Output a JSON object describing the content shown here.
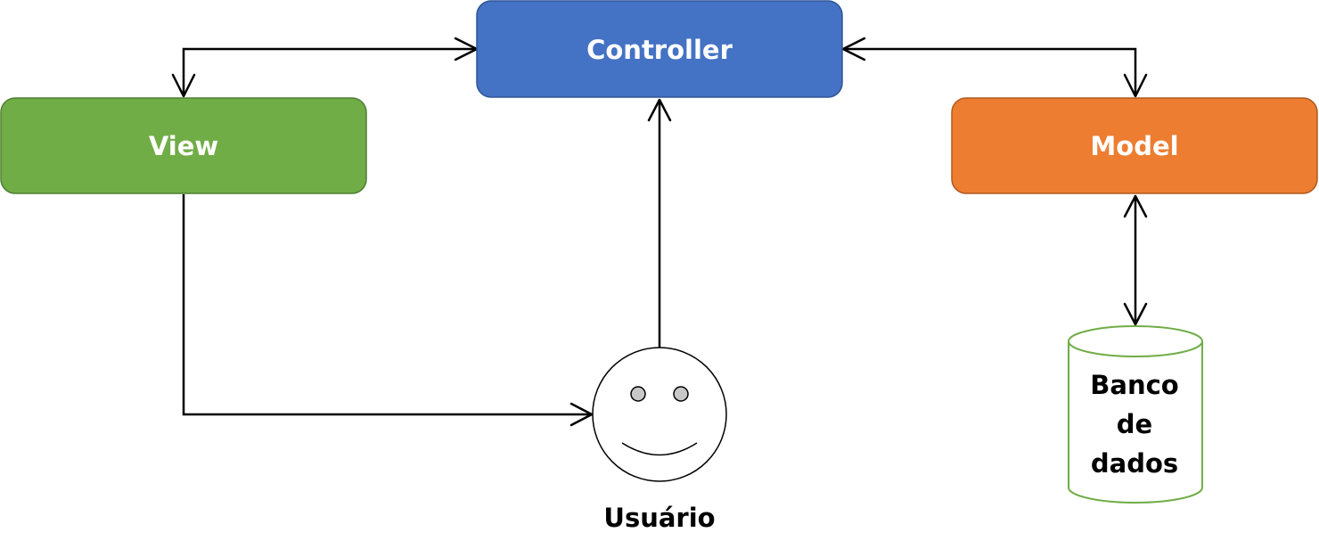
{
  "nodes": {
    "controller": {
      "label": "Controller",
      "fill": "#4472c4",
      "stroke": "#2f5597"
    },
    "view": {
      "label": "View",
      "fill": "#70ad47",
      "stroke": "#507e32"
    },
    "model": {
      "label": "Model",
      "fill": "#ed7d31",
      "stroke": "#ae5a21"
    },
    "user": {
      "label": "Usuário"
    },
    "database": {
      "label_lines": [
        "Banco",
        "de",
        "dados"
      ],
      "stroke": "#70ad47"
    }
  }
}
